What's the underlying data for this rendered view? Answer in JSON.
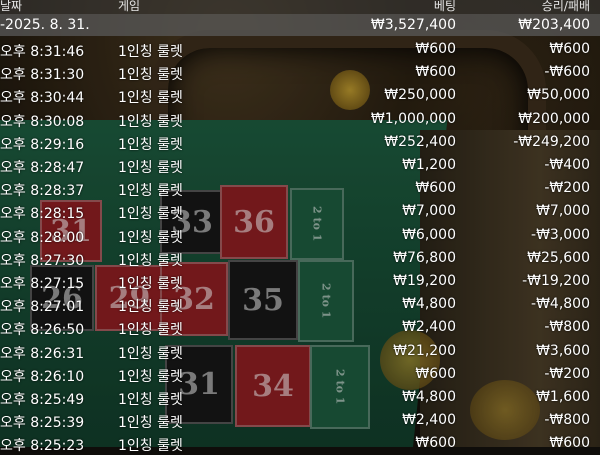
{
  "header": {
    "col_date": "날짜",
    "col_game": "게임",
    "col_bet": "베팅",
    "col_winloss": "승리/패배"
  },
  "summary": {
    "date": "-2025. 8. 31.",
    "total_bet": "₩3,527,400",
    "total_winloss": "₩203,400"
  },
  "rows": [
    {
      "time": "오후 8:31:46",
      "game": "1인칭 룰렛",
      "bet": "₩600",
      "result": "₩600"
    },
    {
      "time": "오후 8:31:30",
      "game": "1인칭 룰렛",
      "bet": "₩600",
      "result": "-₩600"
    },
    {
      "time": "오후 8:30:44",
      "game": "1인칭 룰렛",
      "bet": "₩250,000",
      "result": "₩50,000"
    },
    {
      "time": "오후 8:30:08",
      "game": "1인칭 룰렛",
      "bet": "₩1,000,000",
      "result": "₩200,000"
    },
    {
      "time": "오후 8:29:16",
      "game": "1인칭 룰렛",
      "bet": "₩252,400",
      "result": "-₩249,200"
    },
    {
      "time": "오후 8:28:47",
      "game": "1인칭 룰렛",
      "bet": "₩1,200",
      "result": "-₩400"
    },
    {
      "time": "오후 8:28:37",
      "game": "1인칭 룰렛",
      "bet": "₩600",
      "result": "-₩200"
    },
    {
      "time": "오후 8:28:15",
      "game": "1인칭 룰렛",
      "bet": "₩7,000",
      "result": "₩7,000"
    },
    {
      "time": "오후 8:28:00",
      "game": "1인칭 룰렛",
      "bet": "₩6,000",
      "result": "-₩3,000"
    },
    {
      "time": "오후 8:27:30",
      "game": "1인칭 룰렛",
      "bet": "₩76,800",
      "result": "₩25,600"
    },
    {
      "time": "오후 8:27:15",
      "game": "1인칭 룰렛",
      "bet": "₩19,200",
      "result": "-₩19,200"
    },
    {
      "time": "오후 8:27:01",
      "game": "1인칭 룰렛",
      "bet": "₩4,800",
      "result": "-₩4,800"
    },
    {
      "time": "오후 8:26:50",
      "game": "1인칭 룰렛",
      "bet": "₩2,400",
      "result": "-₩800"
    },
    {
      "time": "오후 8:26:31",
      "game": "1인칭 룰렛",
      "bet": "₩21,200",
      "result": "₩3,600"
    },
    {
      "time": "오후 8:26:10",
      "game": "1인칭 룰렛",
      "bet": "₩600",
      "result": "-₩200"
    },
    {
      "time": "오후 8:25:49",
      "game": "1인칭 룰렛",
      "bet": "₩4,800",
      "result": "₩1,600"
    },
    {
      "time": "오후 8:25:39",
      "game": "1인칭 룰렛",
      "bet": "₩2,400",
      "result": "-₩800"
    },
    {
      "time": "오후 8:25:23",
      "game": "1인칭 룰렛",
      "bet": "₩600",
      "result": "₩600"
    }
  ],
  "background": {
    "cells": [
      "31",
      "33",
      "36",
      "26",
      "29",
      "32",
      "35",
      "31",
      "34"
    ],
    "column_bet_label": "2 to 1",
    "felt_color": "#1d5a3e",
    "red_color": "#8c1e22"
  }
}
